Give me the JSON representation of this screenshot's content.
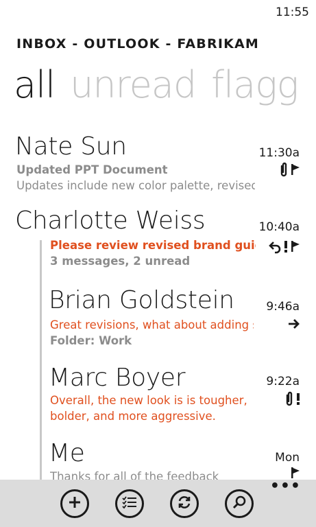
{
  "status": {
    "time": "11:55"
  },
  "header": {
    "title": "INBOX - OUTLOOK - FABRIKAM"
  },
  "pivots": [
    "all",
    "unread",
    "flagg"
  ],
  "messages": [
    {
      "sender": "Nate Sun",
      "time": "11:30a",
      "line1": "Updated PPT Document",
      "line2": "Updates include new color palette, revised",
      "icons": [
        "paperclip-icon",
        "flag-icon"
      ]
    },
    {
      "sender": "Charlotte Weiss",
      "time": "10:40a",
      "line1": "Please review revised brand guide",
      "line2": "3 messages, 2 unread",
      "icons": [
        "reply-icon",
        "high-importance-icon",
        "flag-icon"
      ]
    },
    {
      "sender": "Brian Goldstein",
      "time": "9:46a",
      "line1": "Great revisions, what about adding s",
      "line2": "Folder: Work",
      "icons": [
        "forward-icon"
      ]
    },
    {
      "sender": "Marc Boyer",
      "time": "9:22a",
      "line1": "Overall, the new look is is tougher,",
      "line2": "bolder, and more aggressive.",
      "icons": [
        "paperclip-icon",
        "high-importance-icon"
      ]
    },
    {
      "sender": "Me",
      "time": "Mon",
      "line1": "Thanks for all of the feedback",
      "line2": "",
      "icons": [
        "flag-icon"
      ]
    }
  ],
  "appbar": {
    "buttons": [
      "new-mail",
      "select",
      "sync",
      "search"
    ],
    "more": "•••"
  },
  "colors": {
    "accent": "#e0501f",
    "gray_text": "#8c8c8c",
    "inactive_pivot": "#c6c6c6",
    "appbar_bg": "#dcdcdc"
  }
}
